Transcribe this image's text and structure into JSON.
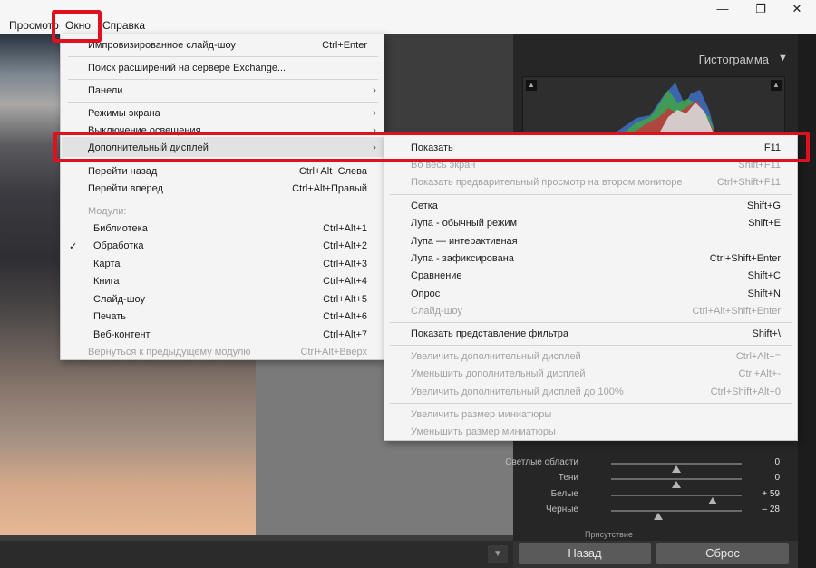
{
  "menubar": {
    "items": [
      "Просмотр",
      "Окно",
      "Справка"
    ],
    "window_controls": {
      "minimize": "—",
      "restore": "❐",
      "close": "✕"
    }
  },
  "window_menu": {
    "items": [
      {
        "label": "Импровизированное слайд-шоу",
        "shortcut": "Ctrl+Enter"
      },
      {
        "label": "Поиск расширений на сервере Exchange...",
        "shortcut": ""
      },
      {
        "label": "Панели",
        "arrow": "›"
      },
      {
        "label": "Режимы экрана",
        "arrow": "›"
      },
      {
        "label": "Выключение освещения",
        "arrow": "›"
      },
      {
        "label": "Дополнительный дисплей",
        "arrow": "›"
      },
      {
        "label": "Перейти назад",
        "shortcut": "Ctrl+Alt+Слева"
      },
      {
        "label": "Перейти вперед",
        "shortcut": "Ctrl+Alt+Правый"
      },
      {
        "label": "Модули:",
        "shortcut": ""
      },
      {
        "label": "Библиотека",
        "shortcut": "Ctrl+Alt+1"
      },
      {
        "label": "Обработка",
        "shortcut": "Ctrl+Alt+2",
        "check": "✓"
      },
      {
        "label": "Карта",
        "shortcut": "Ctrl+Alt+3"
      },
      {
        "label": "Книга",
        "shortcut": "Ctrl+Alt+4"
      },
      {
        "label": "Слайд-шоу",
        "shortcut": "Ctrl+Alt+5"
      },
      {
        "label": "Печать",
        "shortcut": "Ctrl+Alt+6"
      },
      {
        "label": "Веб-контент",
        "shortcut": "Ctrl+Alt+7"
      },
      {
        "label": "Вернуться к предыдущему модулю",
        "shortcut": "Ctrl+Alt+Вверх"
      }
    ]
  },
  "submenu": {
    "items": [
      {
        "label": "Показать",
        "shortcut": "F11"
      },
      {
        "label": "Во весь экран",
        "shortcut": "Shift+F11"
      },
      {
        "label": "Показать предварительный просмотр на втором мониторе",
        "shortcut": "Ctrl+Shift+F11"
      },
      {
        "label": "Сетка",
        "shortcut": "Shift+G"
      },
      {
        "label": "Лупа - обычный режим",
        "shortcut": "Shift+E"
      },
      {
        "label": "Лупа — интерактивная",
        "shortcut": ""
      },
      {
        "label": "Лупа - зафиксирована",
        "shortcut": "Ctrl+Shift+Enter"
      },
      {
        "label": "Сравнение",
        "shortcut": "Shift+C"
      },
      {
        "label": "Опрос",
        "shortcut": "Shift+N"
      },
      {
        "label": "Слайд-шоу",
        "shortcut": "Ctrl+Alt+Shift+Enter"
      },
      {
        "label": "Показать представление фильтра",
        "shortcut": "Shift+\\"
      },
      {
        "label": "Увеличить дополнительный дисплей",
        "shortcut": "Ctrl+Alt+="
      },
      {
        "label": "Уменьшить дополнительный дисплей",
        "shortcut": "Ctrl+Alt+-"
      },
      {
        "label": "Увеличить дополнительный дисплей до 100%",
        "shortcut": "Ctrl+Shift+Alt+0"
      },
      {
        "label": "Увеличить размер миниатюры",
        "shortcut": ""
      },
      {
        "label": "Уменьшить размер миниатюры",
        "shortcut": ""
      }
    ]
  },
  "right_panel": {
    "histogram_title": "Гистограмма",
    "sliders": [
      {
        "label": "Светлые области",
        "value": "0",
        "level": 0.5
      },
      {
        "label": "Тени",
        "value": "0",
        "level": 0.5
      },
      {
        "label": "Белые",
        "value": "+ 59",
        "level": 0.78
      },
      {
        "label": "Черные",
        "value": "– 28",
        "level": 0.36
      }
    ],
    "section_label": "Присутствие",
    "back_button": "Назад",
    "reset_button": "Сброс"
  },
  "colors": {
    "highlight": "#e0101e",
    "panel_bg": "#262626",
    "menu_bg": "#f4f4f4"
  },
  "icons": {
    "collapse": "triangle-down-icon",
    "checkmark": "check-icon",
    "submenu_arrow": "chevron-right-icon"
  }
}
